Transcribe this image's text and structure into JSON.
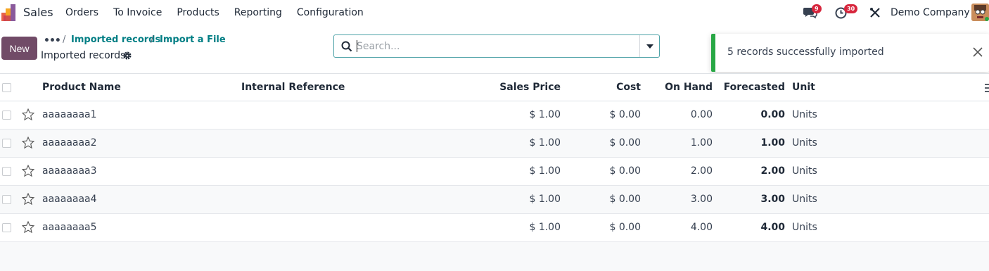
{
  "navbar": {
    "app_name": "Sales",
    "menu": [
      "Orders",
      "To Invoice",
      "Products",
      "Reporting",
      "Configuration"
    ],
    "messages_badge": "9",
    "activities_badge": "30",
    "company": "Demo Company"
  },
  "control": {
    "new_label": "New",
    "breadcrumbs": [
      "Imported records",
      "Import a File"
    ],
    "current_title": "Imported records",
    "search_placeholder": "Search..."
  },
  "toast": {
    "message": "5 records successfully imported"
  },
  "table": {
    "columns": {
      "name": "Product Name",
      "ref": "Internal Reference",
      "price": "Sales Price",
      "cost": "Cost",
      "onhand": "On Hand",
      "forecast": "Forecasted",
      "unit": "Unit"
    },
    "rows": [
      {
        "name": "aaaaaaaa1",
        "ref": "",
        "price": "$ 1.00",
        "cost": "$ 0.00",
        "onhand": "0.00",
        "forecast": "0.00",
        "unit": "Units"
      },
      {
        "name": "aaaaaaaa2",
        "ref": "",
        "price": "$ 1.00",
        "cost": "$ 0.00",
        "onhand": "1.00",
        "forecast": "1.00",
        "unit": "Units"
      },
      {
        "name": "aaaaaaaa3",
        "ref": "",
        "price": "$ 1.00",
        "cost": "$ 0.00",
        "onhand": "2.00",
        "forecast": "2.00",
        "unit": "Units"
      },
      {
        "name": "aaaaaaaa4",
        "ref": "",
        "price": "$ 1.00",
        "cost": "$ 0.00",
        "onhand": "3.00",
        "forecast": "3.00",
        "unit": "Units"
      },
      {
        "name": "aaaaaaaa5",
        "ref": "",
        "price": "$ 1.00",
        "cost": "$ 0.00",
        "onhand": "4.00",
        "forecast": "4.00",
        "unit": "Units"
      }
    ]
  },
  "colors": {
    "brand": "#714b67",
    "link": "#017e84",
    "success": "#28a745",
    "badge": "#d7263d"
  }
}
